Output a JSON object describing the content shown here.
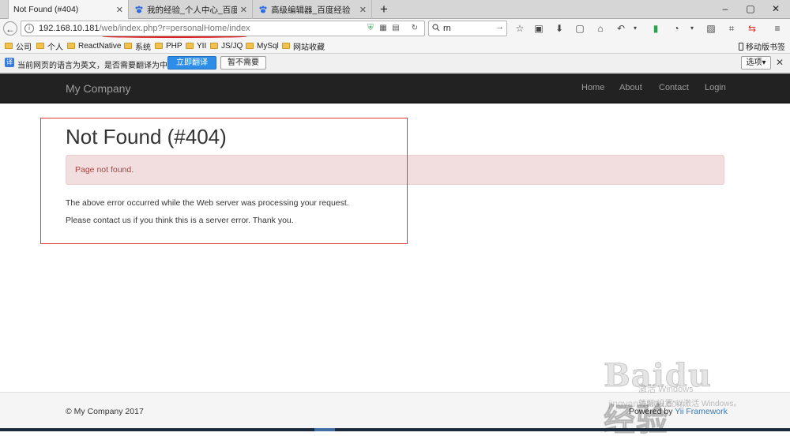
{
  "browser": {
    "tabs": [
      {
        "label": "Not Found (#404)",
        "active": true,
        "icon": "none"
      },
      {
        "label": "我的经验_个人中心_百度经…",
        "active": false,
        "icon": "baidu-paw-icon"
      },
      {
        "label": "高级编辑器_百度经验",
        "active": false,
        "icon": "baidu-paw-icon"
      }
    ],
    "new_tab_label": "+",
    "window_controls": {
      "minimize": "–",
      "maximize": "▢",
      "close": "✕"
    },
    "url": {
      "host": "192.168.10.181",
      "path": "/web/index.php?r=personalHome/index"
    },
    "search": {
      "query": "rn"
    },
    "bookmarks": [
      {
        "label": "公司"
      },
      {
        "label": "个人"
      },
      {
        "label": "ReactNative"
      },
      {
        "label": "系统"
      },
      {
        "label": "PHP"
      },
      {
        "label": "YII"
      },
      {
        "label": "JS/JQ"
      },
      {
        "label": "MySql"
      },
      {
        "label": "网站收藏"
      }
    ],
    "mobile_bookmarks": "移动版书签",
    "translate_bar": {
      "message": "当前网页的语言为英文，是否需要翻译为中文？",
      "translate_button": "立即翻译",
      "dismiss_button": "暂不需要",
      "options_button": "选项▾",
      "close": "✕"
    }
  },
  "site": {
    "brand": "My Company",
    "nav": [
      "Home",
      "About",
      "Contact",
      "Login"
    ],
    "title": "Not Found (#404)",
    "alert": "Page not found.",
    "paragraph1": "The above error occurred while the Web server was processing your request.",
    "paragraph2": "Please contact us if you think this is a server error. Thank you.",
    "footer": {
      "copyright": "© My Company 2017",
      "powered_prefix": "Powered by ",
      "powered_link": "Yii Framework"
    }
  },
  "overlay": {
    "watermark": "Baidu 经验",
    "watermark_url": "jingyan.baidu.com",
    "activate_title": "激活 Windows",
    "activate_sub": "转到\"设置\"以激活 Windows。"
  },
  "colors": {
    "navbar_bg": "#222222",
    "alert_bg": "#f2dede",
    "alert_text": "#a94442",
    "annotation_red": "#e53935",
    "link_blue": "#337ab7",
    "translate_primary": "#2e8de6"
  }
}
